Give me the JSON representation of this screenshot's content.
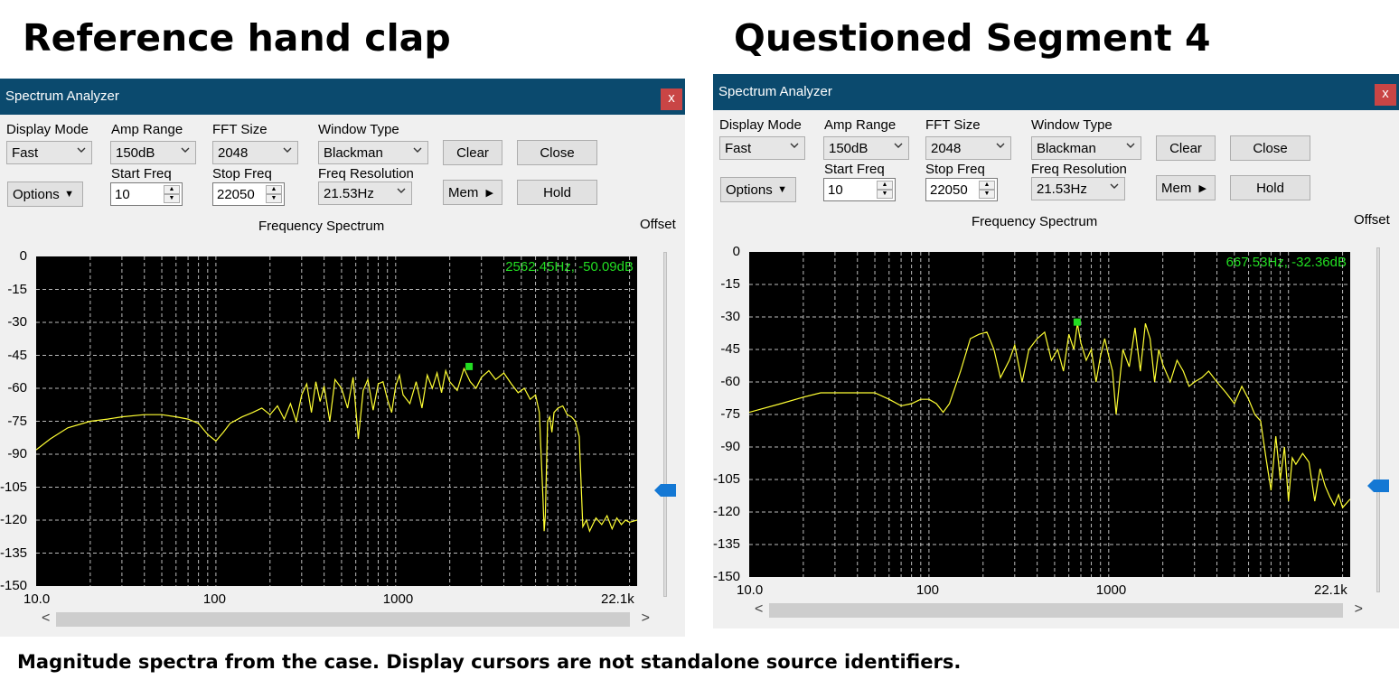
{
  "headings": {
    "left": "Reference hand clap",
    "right": "Questioned Segment 4"
  },
  "caption": "Magnitude spectra from the case. Display cursors are not standalone source identifiers.",
  "colors": {
    "titlebar": "#0b4a6e",
    "close": "#c94545",
    "trace": "#ffff33",
    "cursor": "#22dd22",
    "thumb": "#1478d4"
  },
  "icons": {
    "close": "close-icon",
    "dropdown": "chevron-down-icon",
    "spin": "spin-arrows-icon",
    "slider": "slider-thumb-icon",
    "scroll_left": "chevron-left-icon",
    "scroll_right": "chevron-right-icon"
  },
  "analyzers": [
    {
      "title": "Spectrum Analyzer",
      "close_glyph": "x",
      "labels": {
        "display_mode": "Display Mode",
        "amp_range": "Amp Range",
        "fft_size": "FFT Size",
        "window_type": "Window Type",
        "start_freq": "Start Freq",
        "stop_freq": "Stop Freq",
        "freq_resolution": "Freq Resolution"
      },
      "values": {
        "display_mode": "Fast",
        "amp_range": "150dB",
        "fft_size": "2048",
        "window_type": "Blackman",
        "start_freq": "10",
        "stop_freq": "22050",
        "freq_resolution": "21.53Hz"
      },
      "buttons": {
        "clear": "Clear",
        "close": "Close",
        "options": "Options",
        "mem": "Mem",
        "hold": "Hold"
      },
      "mem_arrow": "▶",
      "options_arrow": "▼",
      "plot_title": "Frequency Spectrum",
      "offset_label": "Offset",
      "y_tick_labels": [
        "0",
        "-15",
        "-30",
        "-45",
        "-60",
        "-75",
        "-90",
        "-105",
        "-120",
        "-135",
        "-150"
      ],
      "x_tick_labels": [
        "10.0",
        "100",
        "1000",
        "22.1k"
      ],
      "readout": "2562.45Hz,  -50.09dB",
      "scroll_left": "<",
      "scroll_right": ">"
    },
    {
      "title": "Spectrum Analyzer",
      "close_glyph": "x",
      "labels": {
        "display_mode": "Display Mode",
        "amp_range": "Amp Range",
        "fft_size": "FFT Size",
        "window_type": "Window Type",
        "start_freq": "Start Freq",
        "stop_freq": "Stop Freq",
        "freq_resolution": "Freq Resolution"
      },
      "values": {
        "display_mode": "Fast",
        "amp_range": "150dB",
        "fft_size": "2048",
        "window_type": "Blackman",
        "start_freq": "10",
        "stop_freq": "22050",
        "freq_resolution": "21.53Hz"
      },
      "buttons": {
        "clear": "Clear",
        "close": "Close",
        "options": "Options",
        "mem": "Mem",
        "hold": "Hold"
      },
      "mem_arrow": "▶",
      "options_arrow": "▼",
      "plot_title": "Frequency Spectrum",
      "offset_label": "Offset",
      "y_tick_labels": [
        "0",
        "-15",
        "-30",
        "-45",
        "-60",
        "-75",
        "-90",
        "-105",
        "-120",
        "-135",
        "-150"
      ],
      "x_tick_labels": [
        "10.0",
        "100",
        "1000",
        "22.1k"
      ],
      "readout": "667.53Hz,  -32.36dB",
      "scroll_left": "<",
      "scroll_right": ">"
    }
  ],
  "chart_data": [
    {
      "type": "line",
      "title": "Frequency Spectrum",
      "x_scale": "log",
      "xlim": [
        10,
        22050
      ],
      "ylim": [
        -150,
        0
      ],
      "grid": true,
      "x_ticks": [
        "10.0",
        "100",
        "1000",
        "22.1k"
      ],
      "y_ticks": [
        0,
        -15,
        -30,
        -45,
        -60,
        -75,
        -90,
        -105,
        -120,
        -135,
        -150
      ],
      "cursor": {
        "freq": 2562.45,
        "db": -50.09
      },
      "offset_level": 0.69,
      "series": [
        {
          "x": [
            10,
            12,
            15,
            20,
            25,
            30,
            40,
            50,
            60,
            70,
            80,
            90,
            100,
            110,
            120,
            140,
            160,
            180,
            200,
            220,
            240,
            260,
            280,
            300,
            320,
            340,
            360,
            380,
            400,
            430,
            460,
            500,
            540,
            580,
            620,
            660,
            700,
            750,
            800,
            850,
            900,
            950,
            1000,
            1050,
            1100,
            1200,
            1300,
            1400,
            1500,
            1600,
            1700,
            1800,
            1900,
            2000,
            2200,
            2400,
            2600,
            2800,
            3000,
            3300,
            3600,
            4000,
            4400,
            4800,
            5200,
            5600,
            6000,
            6300,
            6600,
            6700,
            6800,
            7000,
            7200,
            7400,
            7600,
            8000,
            8500,
            9000,
            9500,
            10000,
            10500,
            11000,
            11500,
            12000,
            13000,
            14000,
            15000,
            16000,
            17000,
            18000,
            19000,
            20000,
            22050
          ],
          "y": [
            -88,
            -83,
            -78,
            -75,
            -74,
            -73,
            -72,
            -72,
            -73,
            -74,
            -76,
            -81,
            -84,
            -80,
            -76,
            -73,
            -71,
            -69,
            -72,
            -68,
            -74,
            -67,
            -75,
            -63,
            -58,
            -71,
            -57,
            -66,
            -59,
            -75,
            -56,
            -60,
            -69,
            -55,
            -83,
            -61,
            -56,
            -70,
            -58,
            -57,
            -65,
            -71,
            -59,
            -54,
            -63,
            -67,
            -57,
            -69,
            -54,
            -60,
            -53,
            -62,
            -52,
            -57,
            -61,
            -51,
            -57,
            -60,
            -55,
            -52,
            -56,
            -53,
            -58,
            -62,
            -60,
            -65,
            -63,
            -71,
            -110,
            -125,
            -118,
            -75,
            -73,
            -80,
            -71,
            -69,
            -68,
            -72,
            -73,
            -75,
            -82,
            -123,
            -120,
            -125,
            -119,
            -122,
            -118,
            -124,
            -119,
            -122,
            -120,
            -121,
            -120
          ]
        }
      ]
    },
    {
      "type": "line",
      "title": "Frequency Spectrum",
      "x_scale": "log",
      "xlim": [
        10,
        22050
      ],
      "ylim": [
        -150,
        0
      ],
      "grid": true,
      "x_ticks": [
        "10.0",
        "100",
        "1000",
        "22.1k"
      ],
      "y_ticks": [
        0,
        -15,
        -30,
        -45,
        -60,
        -75,
        -90,
        -105,
        -120,
        -135,
        -150
      ],
      "cursor": {
        "freq": 667.53,
        "db": -32.36
      },
      "offset_level": 0.69,
      "series": [
        {
          "x": [
            10,
            15,
            20,
            25,
            30,
            40,
            50,
            60,
            70,
            80,
            90,
            100,
            110,
            120,
            130,
            150,
            170,
            190,
            210,
            230,
            250,
            280,
            300,
            330,
            360,
            400,
            440,
            480,
            520,
            560,
            600,
            640,
            670,
            700,
            750,
            800,
            850,
            900,
            950,
            1000,
            1050,
            1100,
            1200,
            1300,
            1400,
            1500,
            1600,
            1700,
            1800,
            1900,
            2000,
            2200,
            2400,
            2600,
            2800,
            3000,
            3300,
            3600,
            4000,
            4500,
            5000,
            5500,
            6000,
            6500,
            7000,
            7500,
            8000,
            8500,
            9000,
            9500,
            10000,
            10500,
            11000,
            12000,
            13000,
            14000,
            15000,
            16000,
            17000,
            18000,
            19000,
            20000,
            22050
          ],
          "y": [
            -74,
            -70,
            -67,
            -65,
            -65,
            -65,
            -65,
            -68,
            -71,
            -70,
            -68,
            -68,
            -70,
            -74,
            -70,
            -55,
            -40,
            -38,
            -37,
            -45,
            -58,
            -50,
            -43,
            -60,
            -45,
            -40,
            -37,
            -50,
            -45,
            -55,
            -38,
            -45,
            -33,
            -42,
            -50,
            -45,
            -60,
            -48,
            -40,
            -48,
            -55,
            -75,
            -45,
            -53,
            -35,
            -55,
            -33,
            -40,
            -60,
            -45,
            -52,
            -60,
            -50,
            -55,
            -62,
            -60,
            -58,
            -55,
            -60,
            -65,
            -70,
            -62,
            -68,
            -75,
            -78,
            -95,
            -110,
            -85,
            -105,
            -90,
            -115,
            -95,
            -98,
            -93,
            -97,
            -115,
            -100,
            -108,
            -113,
            -117,
            -112,
            -118,
            -114
          ]
        }
      ]
    }
  ]
}
